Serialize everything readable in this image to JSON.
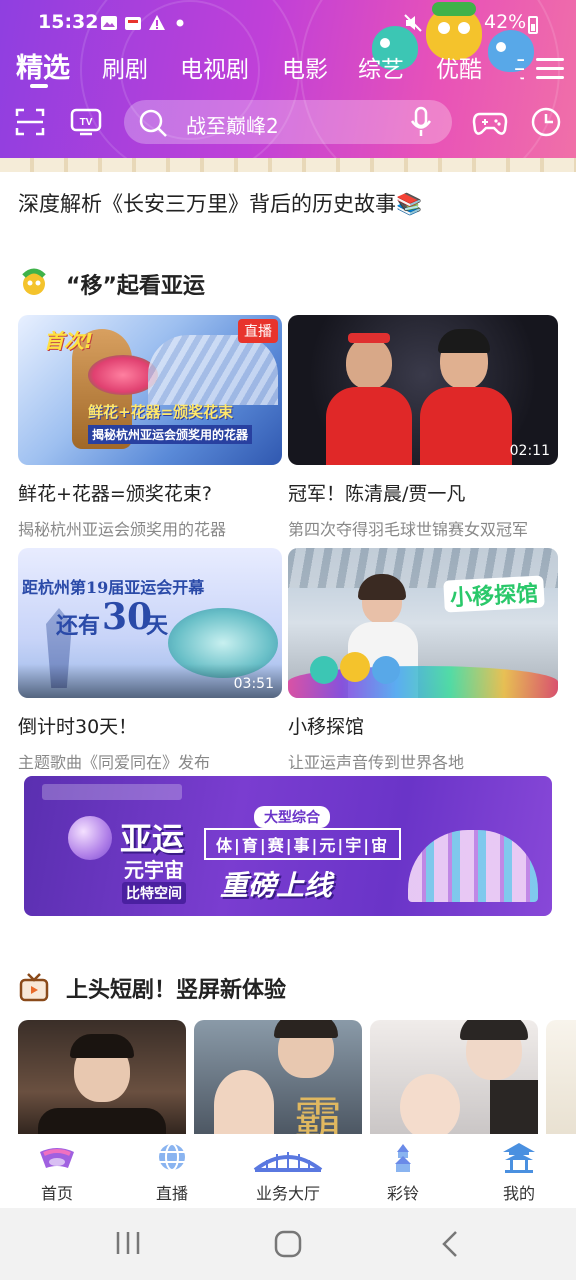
{
  "status_bar": {
    "time": "15:32",
    "battery": "42%"
  },
  "tabs": [
    {
      "label": "精选",
      "active": true
    },
    {
      "label": "刷剧"
    },
    {
      "label": "电视剧"
    },
    {
      "label": "电影"
    },
    {
      "label": "综艺"
    },
    {
      "label": "优酷"
    }
  ],
  "search": {
    "placeholder": "战至巅峰2"
  },
  "feed": {
    "article_title": "深度解析《长安三万里》背后的历史故事📚",
    "section1": {
      "title": "“移”起看亚运",
      "cards": [
        {
          "title": "鲜花+花器=颁奖花束?",
          "subtitle": "揭秘杭州亚运会颁奖用的花器",
          "badge": "直播",
          "thumb_lines": [
            "首次!",
            "鲜花+花器=颁奖花束",
            "揭秘杭州亚运会颁奖用的花器"
          ]
        },
        {
          "title": "冠军！陈清晨/贾一凡",
          "subtitle": "第四次夺得羽毛球世锦赛女双冠军",
          "duration": "02:11"
        },
        {
          "title": "倒计时30天！",
          "subtitle": "主题歌曲《同爱同在》发布",
          "duration": "03:51",
          "thumb_lines": [
            "距杭州第19届亚运会开幕",
            "还有",
            "30",
            "天"
          ]
        },
        {
          "title": "小移探馆",
          "subtitle": "让亚运声音传到世界各地",
          "thumb_lines": [
            "小移探馆"
          ]
        }
      ]
    },
    "banner": {
      "line1": "亚运",
      "line2": "元宇宙",
      "line3": "比特空间",
      "tag": "大型综合",
      "chars": "体|育|赛|事|元|宇|宙",
      "slogan": "重磅上线"
    },
    "section2": {
      "title": "上头短剧！竖屏新体验"
    }
  },
  "bottom_nav": [
    {
      "label": "首页"
    },
    {
      "label": "直播"
    },
    {
      "label": "业务大厅"
    },
    {
      "label": "彩铃"
    },
    {
      "label": "我的"
    }
  ],
  "colors": {
    "header_start": "#8f3fe0",
    "header_end": "#f070a8",
    "live_badge": "#e8342c"
  }
}
